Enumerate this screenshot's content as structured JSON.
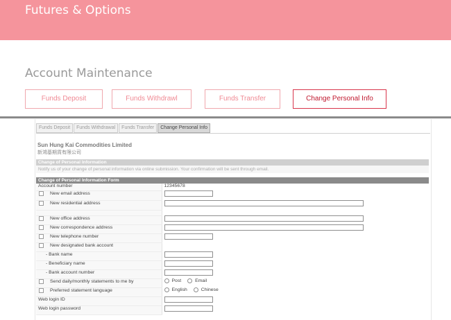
{
  "banner": {
    "title": "Futures & Options"
  },
  "section": {
    "title": "Account Maintenance"
  },
  "top_tabs": [
    {
      "label": "Funds Deposit",
      "active": false
    },
    {
      "label": "Funds Withdrawl",
      "active": false
    },
    {
      "label": "Funds Transfer",
      "active": false
    },
    {
      "label": "Change Personal Info",
      "active": true
    }
  ],
  "sub_tabs": [
    {
      "label": "Funds Deposit",
      "active": false
    },
    {
      "label": "Funds Withdrawal",
      "active": false
    },
    {
      "label": "Funds Transfer",
      "active": false
    },
    {
      "label": "Change Personal Info",
      "active": true
    }
  ],
  "company": {
    "name_en": "Sun Hung Kai Commodities Limited",
    "name_zh": "新鴻基期貨有限公司"
  },
  "info_section": {
    "header": "Change of Personal Information",
    "notice": "Notify us of your change of personal information via online submission. Your confirmation will be sent through email."
  },
  "form": {
    "header": "Change of Personal Information Form",
    "account_label": "Account number",
    "account_value": "12345678",
    "fields": {
      "email": "New email address",
      "residential": "New residential address",
      "office": "New office address",
      "correspondence": "New correspondence address",
      "telephone": "New telephone number",
      "bank": "New designated bank account",
      "bank_name": "- Bank name",
      "beneficiary": "- Beneficiary name",
      "bank_account": "- Bank account number",
      "statements": "Send daily/monthly statements to me by",
      "language": "Preferred statement language",
      "login_id": "Web login ID",
      "login_password": "Web login password"
    },
    "statement_options": [
      "Post",
      "Email"
    ],
    "language_options": [
      "English",
      "Chinese"
    ]
  },
  "colors": {
    "banner": "#f5949c",
    "accent": "#c0182e",
    "tab_border": "#f0a7ad"
  }
}
